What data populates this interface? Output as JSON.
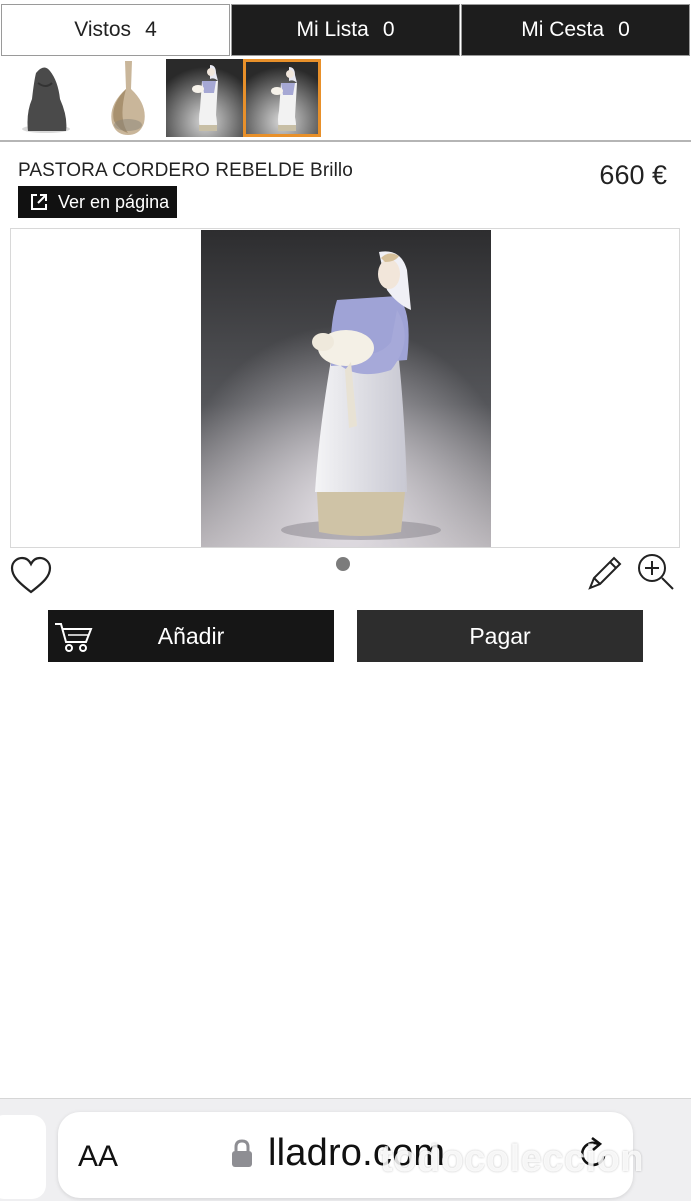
{
  "tabs": [
    {
      "label": "Vistos",
      "count": "4"
    },
    {
      "label": "Mi Lista",
      "count": "0"
    },
    {
      "label": "Mi Cesta",
      "count": "0"
    }
  ],
  "thumbnails": {
    "selected_index": 3,
    "items": [
      "figurine-monk-icon",
      "vase-icon",
      "shepherdess-figurine-icon",
      "shepherdess-figurine-icon"
    ]
  },
  "product": {
    "title": "PASTORA CORDERO REBELDE Brillo",
    "price": "660 €",
    "view_page_label": "Ver en página"
  },
  "actions": {
    "add_label": "Añadir",
    "pay_label": "Pagar"
  },
  "browser": {
    "aa_label": "AA",
    "domain": "lladro.com"
  },
  "watermark": "todocoleccion",
  "colors": {
    "dark_button": "#161616",
    "selected_thumb_border": "#e8902a"
  }
}
